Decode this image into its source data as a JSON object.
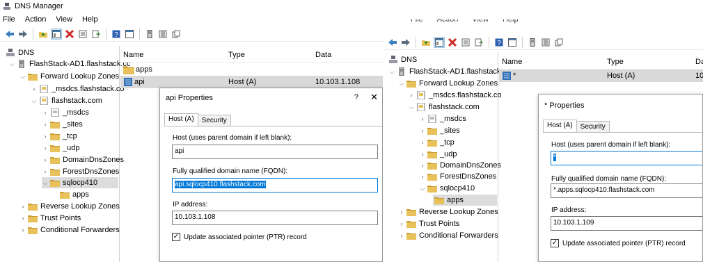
{
  "left": {
    "app_title": "DNS Manager",
    "menu": [
      "File",
      "Action",
      "View",
      "Help"
    ],
    "tree": {
      "root": "DNS",
      "server": "FlashStack-AD1.flashstack.cc",
      "forward_zones": "Forward Lookup Zones",
      "msdcs_zone": "_msdcs.flashstack.co",
      "flashstack_zone": "flashstack.com",
      "msdcs": "_msdcs",
      "sites": "_sites",
      "tcp": "_tcp",
      "udp": "_udp",
      "domaindns": "DomainDnsZones",
      "forestdns": "ForestDnsZones",
      "sqlocp410": "sqlocp410",
      "apps": "apps",
      "reverse_zones": "Reverse Lookup Zones",
      "trust_points": "Trust Points",
      "conditional_forwarders": "Conditional Forwarders"
    },
    "list": {
      "headers": {
        "name": "Name",
        "type": "Type",
        "data": "Data"
      },
      "rows": [
        {
          "name": "apps",
          "type": "",
          "data": ""
        },
        {
          "name": "api",
          "type": "Host (A)",
          "data": "10.103.1.108"
        }
      ]
    },
    "dialog": {
      "title": "api Properties",
      "help": "?",
      "close": "✕",
      "tabs": [
        "Host (A)",
        "Security"
      ],
      "host_label": "Host (uses parent domain if left blank):",
      "host_value": "api",
      "fqdn_label": "Fully qualified domain name (FQDN):",
      "fqdn_value": "api.sqlocp410.flashstack.com",
      "ip_label": "IP address:",
      "ip_value": "10.103.1.108",
      "ptr_label": "Update associated pointer (PTR) record",
      "ptr_checked": true
    }
  },
  "right": {
    "menu": [
      "File",
      "Action",
      "View",
      "Help"
    ],
    "tree": {
      "root": "DNS",
      "server": "FlashStack-AD1.flashstack.cc",
      "forward_zones": "Forward Lookup Zones",
      "msdcs_zone": "_msdcs.flashstack.co",
      "flashstack_zone": "flashstack.com",
      "msdcs": "_msdcs",
      "sites": "_sites",
      "tcp": "_tcp",
      "udp": "_udp",
      "domaindns": "DomainDnsZones",
      "forestdns": "ForestDnsZones",
      "sqlocp410": "sqlocp410",
      "apps": "apps",
      "reverse_zones": "Reverse Lookup Zones",
      "trust_points": "Trust Points",
      "conditional_forwarders": "Conditional Forwarders"
    },
    "list": {
      "headers": {
        "name": "Name",
        "type": "Type",
        "data": "Da"
      },
      "rows": [
        {
          "name": "*",
          "type": "Host (A)",
          "data": "10."
        }
      ]
    },
    "dialog": {
      "title": "* Properties",
      "tabs": [
        "Host (A)",
        "Security"
      ],
      "host_label": "Host (uses parent domain if left blank):",
      "host_value": "*",
      "fqdn_label": "Fully qualified domain name (FQDN):",
      "fqdn_value": "*.apps.sqlocp410.flashstack.com",
      "ip_label": "IP address:",
      "ip_value": "10.103.1.109",
      "ptr_label": "Update associated pointer (PTR) record",
      "ptr_checked": true
    }
  },
  "colors": {
    "folder": "#e8c15a",
    "folder_dark": "#c99a2e",
    "selection": "#0078d7",
    "back_arrow": "#3c7fc1",
    "delete_red": "#d0302b"
  }
}
